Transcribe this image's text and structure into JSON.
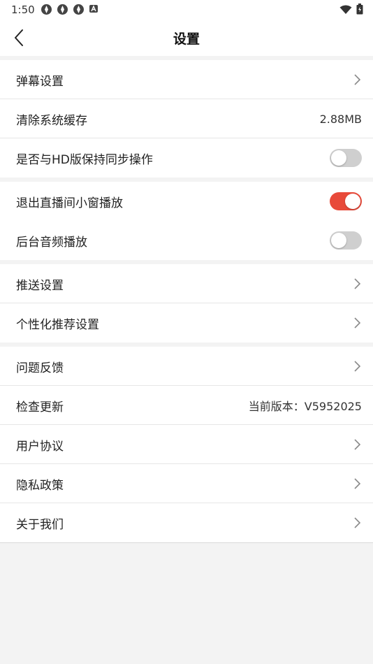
{
  "status_bar": {
    "time": "1:50",
    "icons": [
      "app-icon",
      "app-icon",
      "app-icon",
      "a-icon"
    ],
    "right_icons": [
      "wifi-icon",
      "battery-icon"
    ]
  },
  "header": {
    "title": "设置",
    "back_icon": "chevron-left-icon"
  },
  "groups": [
    {
      "items": [
        {
          "label": "弹幕设置",
          "type": "chevron"
        },
        {
          "label": "清除系统缓存",
          "type": "value",
          "value": "2.88MB"
        },
        {
          "label": "是否与HD版保持同步操作",
          "type": "toggle",
          "on": false
        }
      ]
    },
    {
      "items": [
        {
          "label": "退出直播间小窗播放",
          "type": "toggle",
          "on": true
        },
        {
          "label": "后台音频播放",
          "type": "toggle",
          "on": false
        }
      ]
    },
    {
      "items": [
        {
          "label": "推送设置",
          "type": "chevron"
        },
        {
          "label": "个性化推荐设置",
          "type": "chevron"
        }
      ]
    },
    {
      "items": [
        {
          "label": "问题反馈",
          "type": "chevron"
        },
        {
          "label": "检查更新",
          "type": "value",
          "value": "当前版本：V5952025"
        },
        {
          "label": "用户协议",
          "type": "chevron"
        },
        {
          "label": "隐私政策",
          "type": "chevron"
        },
        {
          "label": "关于我们",
          "type": "chevron"
        }
      ]
    }
  ],
  "colors": {
    "toggle_on": "#e84a3a",
    "toggle_off": "#cfcfcf",
    "background": "#f3f3f3"
  }
}
